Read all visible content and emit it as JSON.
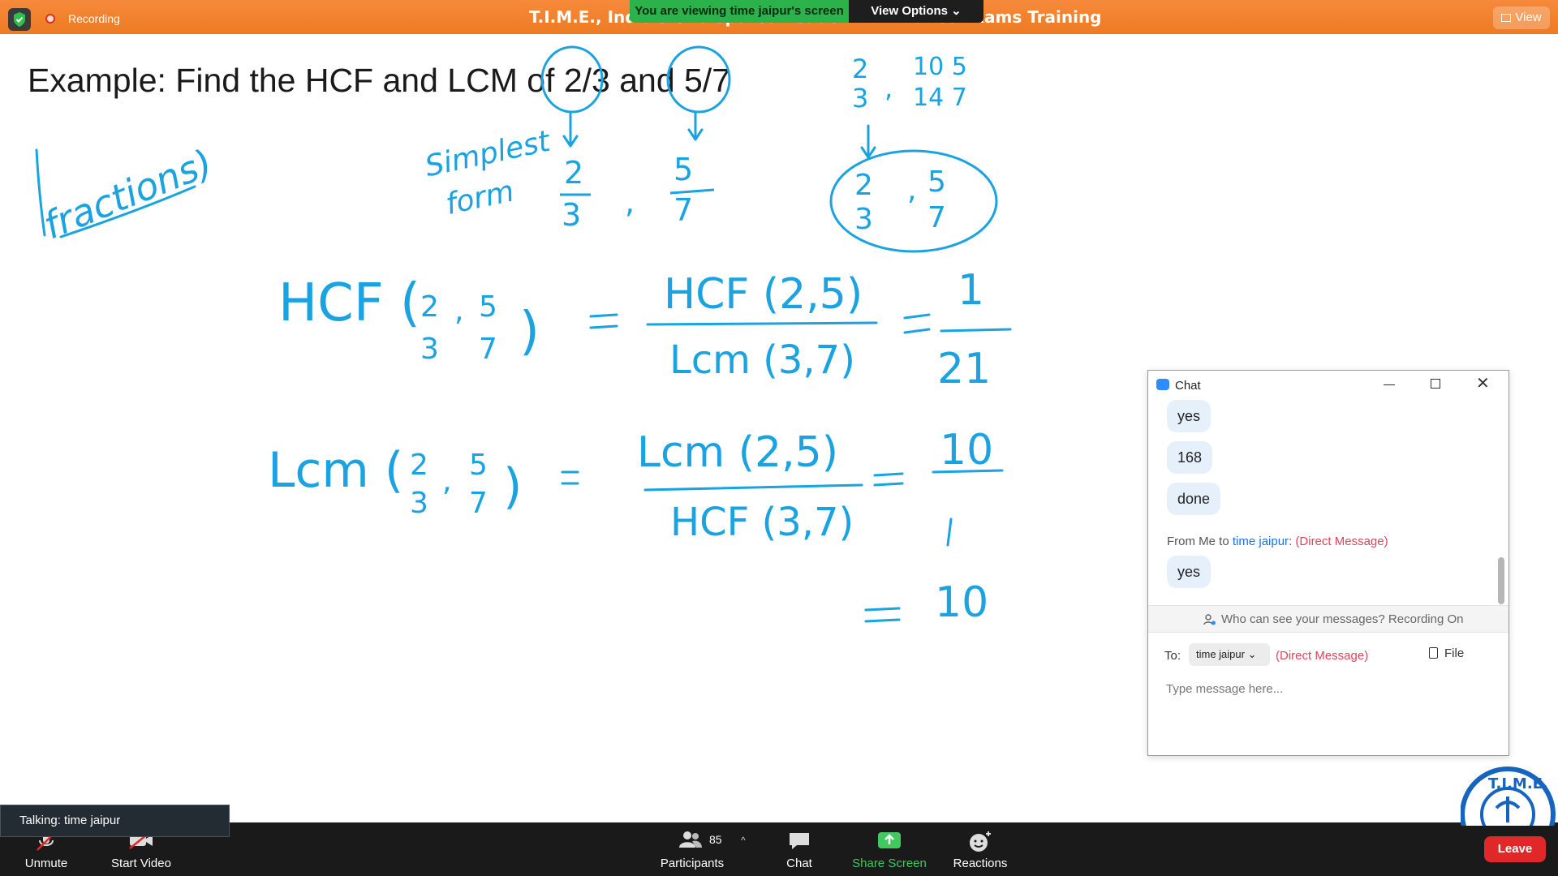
{
  "topbar": {
    "recording_label": "Recording",
    "meeting_title": "T.I.M.E., India's Undisputed Leader in Entrance Exams Training",
    "view_label": "View"
  },
  "share_banner": {
    "viewing_text": "You are viewing time jaipur's screen",
    "view_options_label": "View Options"
  },
  "whiteboard": {
    "title": "Example: Find the HCF and LCM of 2/3 and 5/7"
  },
  "chat": {
    "title": "Chat",
    "messages": [
      {
        "text": "yes"
      },
      {
        "text": "168"
      },
      {
        "text": "done"
      },
      {
        "text": "yes"
      }
    ],
    "from_line": {
      "prefix": "From Me to ",
      "name": "time jaipur",
      "colon": ":",
      "dm": "(Direct Message)"
    },
    "privacy_text": "Who can see your messages? Recording On",
    "to_label": "To:",
    "to_value": "time jaipur",
    "to_dm": "(Direct Message)",
    "file_label": "File",
    "input_placeholder": "Type message here..."
  },
  "talking": {
    "text": "Talking: time jaipur"
  },
  "toolbar": {
    "unmute_label": "Unmute",
    "start_video_label": "Start Video",
    "participants_label": "Participants",
    "participants_count": "85",
    "chat_label": "Chat",
    "share_label": "Share Screen",
    "reactions_label": "Reactions",
    "leave_label": "Leave"
  },
  "colors": {
    "ink": "#1aa3e0",
    "topbar_orange": "#f28130",
    "share_green": "#41c95f",
    "leave_red": "#e02828",
    "chat_bubble": "#e6f0fb"
  }
}
